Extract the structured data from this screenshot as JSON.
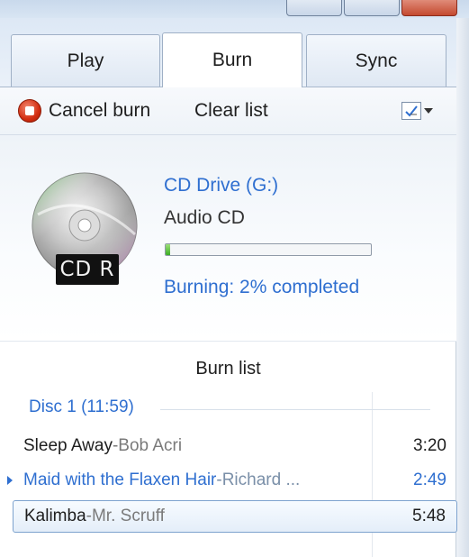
{
  "tabs": {
    "play": "Play",
    "burn": "Burn",
    "sync": "Sync",
    "active": "Burn"
  },
  "toolbar": {
    "cancel_label": "Cancel burn",
    "clear_label": "Clear list",
    "cancel_icon": "stop-icon",
    "options_icon": "burn-options-icon"
  },
  "drive": {
    "name": "CD Drive (G:)",
    "type": "Audio CD",
    "disc_label": "CD R",
    "progress_percent": 2,
    "status": "Burning: 2% completed",
    "icon": "cd-r-disc-icon"
  },
  "burn_list": {
    "title": "Burn list",
    "disc_header": "Disc 1 (11:59)",
    "tracks": [
      {
        "title": "Sleep Away",
        "separator": " - ",
        "artist": "Bob Acri",
        "duration": "3:20",
        "state": "normal"
      },
      {
        "title": "Maid with the Flaxen Hair",
        "separator": " - ",
        "artist": "Richard ...",
        "duration": "2:49",
        "state": "burning"
      },
      {
        "title": "Kalimba",
        "separator": " - ",
        "artist": "Mr. Scruff",
        "duration": "5:48",
        "state": "selected"
      }
    ]
  },
  "colors": {
    "link_blue": "#2f6fd0",
    "progress_green": "#3cae25",
    "stop_red": "#d32d10",
    "tab_border": "#9fb0c6"
  }
}
